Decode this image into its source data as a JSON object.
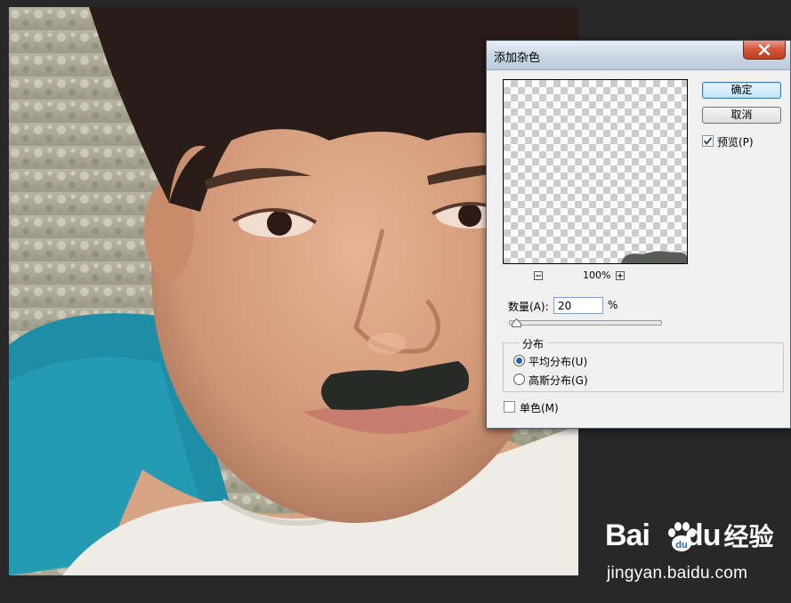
{
  "dialog": {
    "title": "添加杂色",
    "ok_label": "确定",
    "cancel_label": "取消",
    "preview_label": "预览(P)",
    "preview_checked": true,
    "zoom_level": "100%",
    "amount_label": "数量(A):",
    "amount_value": "20",
    "amount_unit": "%",
    "distribution": {
      "group_label": "分布",
      "options": [
        {
          "label": "平均分布(U)",
          "selected": true
        },
        {
          "label": "高斯分布(G)",
          "selected": false
        }
      ]
    },
    "monochromatic_label": "单色(M)",
    "monochromatic_checked": false
  },
  "watermark": {
    "brand_left": "Bai",
    "brand_right": "du",
    "product": "经验",
    "url": "jingyan.baidu.com"
  },
  "colors": {
    "workspace_bg": "#282828",
    "dialog_bg": "#f0f0f0",
    "close_button": "#c94a30",
    "radio_selected": "#1f67b0"
  }
}
